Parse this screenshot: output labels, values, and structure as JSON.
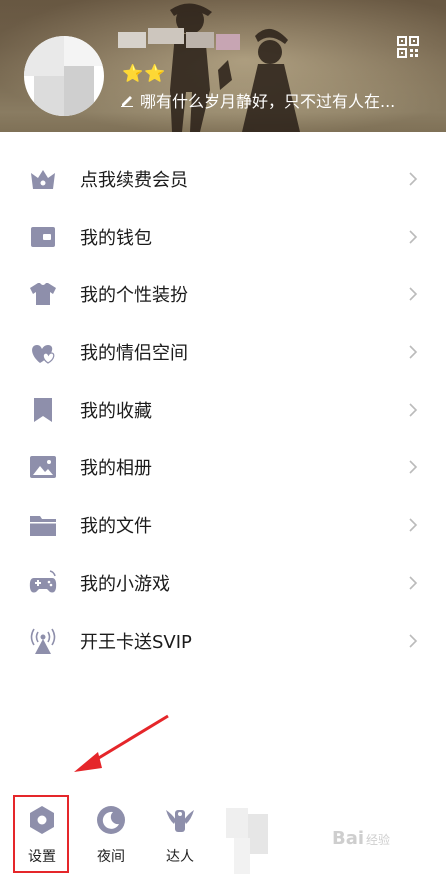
{
  "profile": {
    "signature": "哪有什么岁月静好，只不过有人在...",
    "level_stars": "⭐⭐"
  },
  "icons": {
    "qr": "qr-code-icon",
    "pen": "edit-pen-icon"
  },
  "menu": [
    {
      "label": "点我续费会员",
      "icon": "crown-icon"
    },
    {
      "label": "我的钱包",
      "icon": "wallet-icon"
    },
    {
      "label": "我的个性装扮",
      "icon": "tshirt-icon"
    },
    {
      "label": "我的情侣空间",
      "icon": "couple-hearts-icon"
    },
    {
      "label": "我的收藏",
      "icon": "bookmark-icon"
    },
    {
      "label": "我的相册",
      "icon": "photo-album-icon"
    },
    {
      "label": "我的文件",
      "icon": "folder-icon"
    },
    {
      "label": "我的小游戏",
      "icon": "gamepad-icon"
    },
    {
      "label": "开王卡送SVIP",
      "icon": "signal-tower-icon"
    }
  ],
  "bottom_bar": {
    "settings": "设置",
    "night": "夜间",
    "expert": "达人"
  },
  "watermark": {
    "text": "Bai",
    "suffix": "经验"
  },
  "colors": {
    "icon": "#8e8fab",
    "chevron": "#bbbbbb",
    "highlight": "#e5262a"
  }
}
